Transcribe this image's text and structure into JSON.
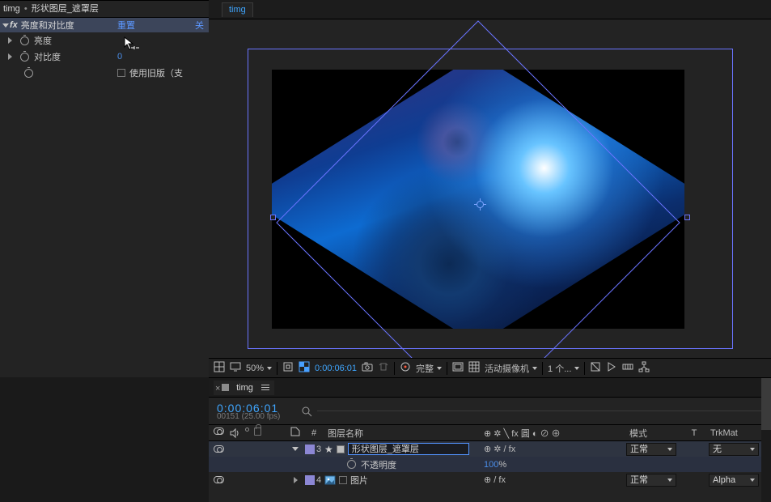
{
  "effects": {
    "crumb_comp": "timg",
    "crumb_sep": "•",
    "crumb_layer": "形状图层_遮罩层",
    "effect_name": "亮度和对比度",
    "reset": "重置",
    "close": "关",
    "rows": {
      "brightness": {
        "label": "亮度",
        "value": ""
      },
      "contrast": {
        "label": "对比度",
        "value": "0"
      },
      "legacy": {
        "label": "使用旧版（支"
      }
    }
  },
  "viewer": {
    "tab": "timg",
    "footer": {
      "zoom": "50%",
      "timecode": "0:00:06:01",
      "quality": "完整",
      "camera": "活动摄像机",
      "views": "1 个..."
    }
  },
  "timeline": {
    "tab": "timg",
    "timecode": "0:00:06:01",
    "frames_fps": "00151 (25.00 fps)",
    "columns": {
      "tag": "#",
      "name": "图层名称",
      "mode": "模式",
      "t": "T",
      "trk": "TrkMat"
    },
    "switch_icons": "⊕ ✲ ╲ fx 圓 ◐ ⊘ ⊕",
    "layers": [
      {
        "index": "3",
        "name": "形状图层_遮罩层",
        "switches": "⊕ ✲   / fx",
        "mode": "正常",
        "trk": "无",
        "prop": {
          "name": "不透明度",
          "value": "100",
          "suffix": "%"
        }
      },
      {
        "index": "4",
        "name": "图片",
        "switches": "⊕     / fx",
        "mode": "正常",
        "trk": "Alpha"
      }
    ]
  }
}
